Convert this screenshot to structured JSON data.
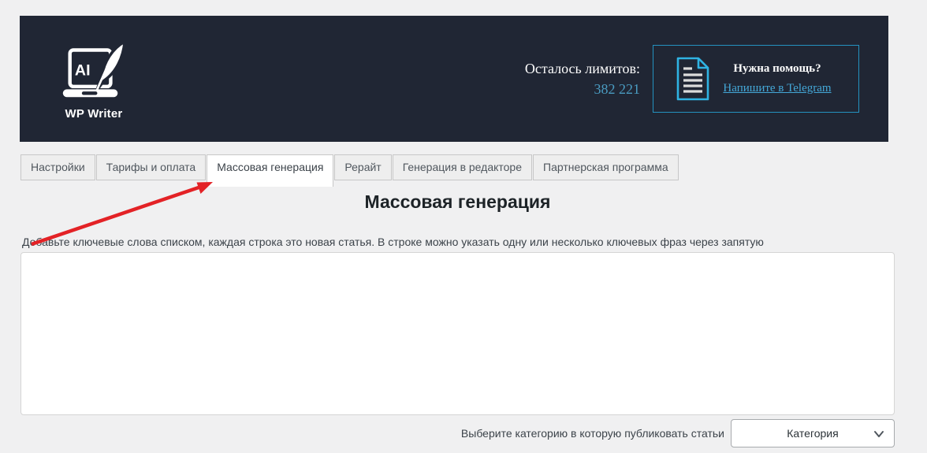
{
  "header": {
    "logo": {
      "ai_label": "AI",
      "brand": "WP Writer"
    },
    "limits": {
      "label": "Осталось лимитов:",
      "value": "382 221"
    },
    "help": {
      "title": "Нужна помощь?",
      "link": "Напишите в Telegram"
    }
  },
  "tabs": [
    {
      "label": "Настройки",
      "active": false
    },
    {
      "label": "Тарифы и оплата",
      "active": false
    },
    {
      "label": "Массовая генерация",
      "active": true
    },
    {
      "label": "Рерайт",
      "active": false
    },
    {
      "label": "Генерация в редакторе",
      "active": false
    },
    {
      "label": "Партнерская программа",
      "active": false
    }
  ],
  "main": {
    "title": "Массовая генерация",
    "description": "Добавьте ключевые слова списком, каждая строка это новая статья. В строке можно указать одну или несколько ключевых фраз через запятую",
    "textarea_value": "",
    "category": {
      "label": "Выберите категорию в которую публиковать статьи",
      "selected": "Категория"
    }
  },
  "annotation": {
    "arrow_points_to": "Массовая генерация"
  },
  "colors": {
    "header_bg": "#202634",
    "accent_cyan_border": "#2492c0",
    "accent_cyan_icon": "#2fb3e3",
    "link_cyan": "#44a8d8",
    "limits_value_blue": "#4a9cc2",
    "arrow_red": "#e32226",
    "page_bg": "#f0f0f1"
  }
}
